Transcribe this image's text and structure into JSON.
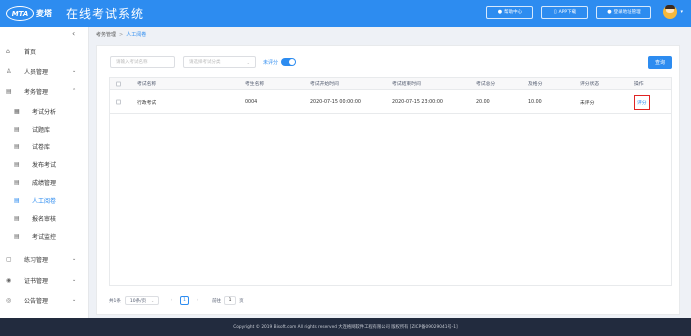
{
  "header": {
    "logo_mark": "MTA",
    "logo_text": "麦塔",
    "title": "在线考试系统",
    "help_label": "帮助中心",
    "app_label": "APP下载",
    "register_label": "登录地址管理",
    "help_icon": "help-icon",
    "app_icon": "phone-icon",
    "register_icon": "user-icon"
  },
  "sidebar": {
    "collapse_icon": "‹",
    "items": [
      {
        "label": "首页",
        "icon": "⌂"
      },
      {
        "label": "人员管理",
        "icon": "♙",
        "arrow": "⌄"
      },
      {
        "label": "考务管理",
        "icon": "▤",
        "arrow": "⌃"
      },
      {
        "label": "考试分析",
        "icon": "▦"
      },
      {
        "label": "试题库",
        "icon": "▤"
      },
      {
        "label": "试卷库",
        "icon": "▤"
      },
      {
        "label": "发布考试",
        "icon": "▤"
      },
      {
        "label": "成绩管理",
        "icon": "▤"
      },
      {
        "label": "人工阅卷",
        "icon": "▤"
      },
      {
        "label": "报名审核",
        "icon": "▤"
      },
      {
        "label": "考试监控",
        "icon": "▤"
      },
      {
        "label": "练习管理",
        "icon": "▢",
        "arrow": "⌄"
      },
      {
        "label": "证书管理",
        "icon": "◉",
        "arrow": "⌄"
      },
      {
        "label": "公告管理",
        "icon": "◎",
        "arrow": "⌄"
      }
    ]
  },
  "breadcrumb": {
    "parent": "考务管理",
    "separator": ">",
    "current": "人工阅卷"
  },
  "filters": {
    "exam_name_placeholder": "请输入考试名称",
    "exam_category_placeholder": "请选择考试分类",
    "toggle_label": "未评分",
    "toggle_on": true,
    "query_label": "查询"
  },
  "table": {
    "headers": [
      "考试名称",
      "考生名称",
      "考试开始时间",
      "考试结束时间",
      "考试总分",
      "及格分",
      "评分状态",
      "操作"
    ],
    "rows": [
      {
        "exam_name": "行政考试",
        "examinee": "0004",
        "start_time": "2020-07-15 00:00:00",
        "end_time": "2020-07-15 23:00:00",
        "total_score": "20.00",
        "pass_score": "10.00",
        "status": "未评分",
        "action": "评分"
      }
    ]
  },
  "pagination": {
    "total": "共1条",
    "page_size": "10条/页",
    "prev": "‹",
    "current_page": "1",
    "next": "›",
    "goto_label": "前往",
    "goto_value": "1",
    "page_suffix": "页"
  },
  "footer": {
    "copyright": "Copyright © 2019 Bisoft.com All rights reserved 大连格网软件工程有限公司 版权所有 [ZICP备09029041号-1]"
  },
  "colors": {
    "primary": "#2d8cf0",
    "footer_bg": "#222b3e",
    "highlight_border": "#e02424"
  }
}
